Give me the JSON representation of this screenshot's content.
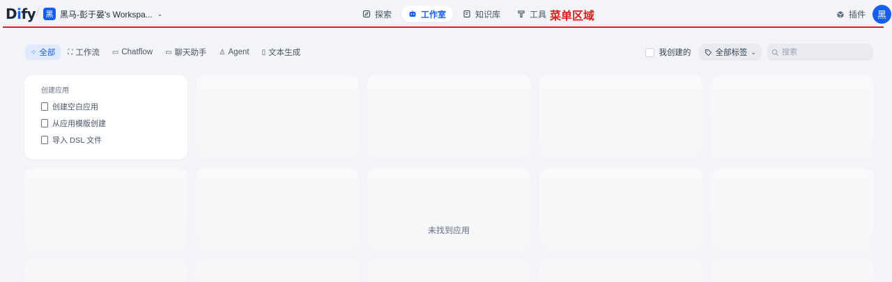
{
  "header": {
    "logo_prefix": "D",
    "logo_i": "i",
    "logo_suffix": "fy",
    "workspace": {
      "avatar": "黑",
      "name": "黑马-彭于晏's Workspa...",
      "chevron": "⌄"
    },
    "nav": [
      {
        "label": "探索",
        "icon": "compass-icon",
        "active": false
      },
      {
        "label": "工作室",
        "icon": "robot-icon",
        "active": true
      },
      {
        "label": "知识库",
        "icon": "book-icon",
        "active": false
      },
      {
        "label": "工具",
        "icon": "hammer-icon",
        "active": false
      }
    ],
    "annotation": "菜单区域",
    "plugins_label": "插件",
    "user_avatar": "黑"
  },
  "filters": {
    "tabs": [
      {
        "label": "全部",
        "icon": "grid-icon",
        "active": true
      },
      {
        "label": "工作流",
        "icon": "workflow-icon",
        "active": false
      },
      {
        "label": "Chatflow",
        "icon": "chat-icon",
        "active": false
      },
      {
        "label": "聊天助手",
        "icon": "chat-bubble-icon",
        "active": false
      },
      {
        "label": "Agent",
        "icon": "agent-icon",
        "active": false
      },
      {
        "label": "文本生成",
        "icon": "doc-icon",
        "active": false
      }
    ],
    "mine_label": "我创建的",
    "tags_label": "全部标签",
    "search_placeholder": "搜索"
  },
  "create": {
    "title": "创建应用",
    "items": [
      "创建空白应用",
      "从应用模版创建",
      "导入 DSL 文件"
    ]
  },
  "empty_text": "未找到应用",
  "colors": {
    "accent": "#155eef",
    "annotation": "#e31b1b",
    "background": "#f2f4f7"
  }
}
